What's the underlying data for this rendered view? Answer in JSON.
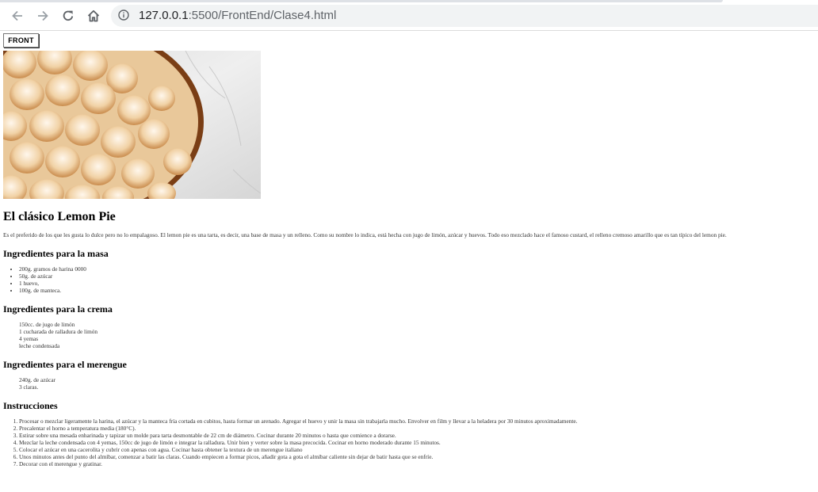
{
  "browser": {
    "url_host": "127.0.0.1",
    "url_path": ":5500/FrontEnd/Clase4.html",
    "icons": [
      "back-icon",
      "forward-icon",
      "reload-icon",
      "home-icon",
      "info-icon"
    ]
  },
  "page": {
    "button_label": "FRONT",
    "title": "El clásico Lemon Pie",
    "intro": "Es el preferido de los que les gusta lo dulce pero no lo empalagoso. El lemon pie es una tarta, es decir, una base de masa y un relleno. Como su nombre lo indica, está hecha con jugo de limón, azúcar y huevos. Todo eso mezclado hace el famoso custard, el relleno cremoso amarillo que es tan típico del lemon pie.",
    "masa": {
      "heading": "Ingredientes para la masa",
      "items": [
        "200g. gramos de harina 0000",
        "50g. de azúcar",
        "1 huevo,",
        "100g. de manteca."
      ]
    },
    "crema": {
      "heading": "Ingredientes para la crema",
      "items": [
        "150cc. de jugo de limón",
        "1 cucharada de ralladura de limón",
        "4 yemas",
        "leche condensada"
      ]
    },
    "merengue": {
      "heading": "Ingredientes para el merengue",
      "items": [
        "240g. de azúcar",
        "3 claras."
      ]
    },
    "instrucciones": {
      "heading": "Instrucciones",
      "steps": [
        "Procesar o mezclar ligeramente la harina, el azúcar y la manteca fría cortada en cubitos, hasta formar un arenado. Agregar el huevo y unir la masa sin trabajarla mucho. Envolver en film y llevar a la heladera por 30 minutos aproximadamente.",
        "Precalentar el horno a temperatura media (180°C).",
        "Estirar sobre una mesada enharinada y tapizar un molde para tarta desmontable de 22 cm de diámetro. Cocinar durante 20 minutos o hasta que comience a dorarse.",
        "Mezclar la leche condensada con 4 yemas, 150cc de jugo de limón e integrar la ralladura. Unir bien y verter sobre la masa precocida. Cocinar en horno moderado durante 15 minutos.",
        "Colocar el azúcar en una cacerolita y cubrir con apenas con agua. Cocinar hasta obtener la textura de un merengue italiano",
        "Unos minutos antes del punto del almíbar, comenzar a batir las claras. Cuando empiecen a formar picos, añadir gota a gota el almíbar caliente sin dejar de batir hasta que se enfríe.",
        "Decorar con el merengue y gratinar."
      ]
    },
    "colors": {
      "crust": "#8a4a1c",
      "meringue": "#f4e3c8",
      "marble": "#e9e9e9"
    }
  }
}
